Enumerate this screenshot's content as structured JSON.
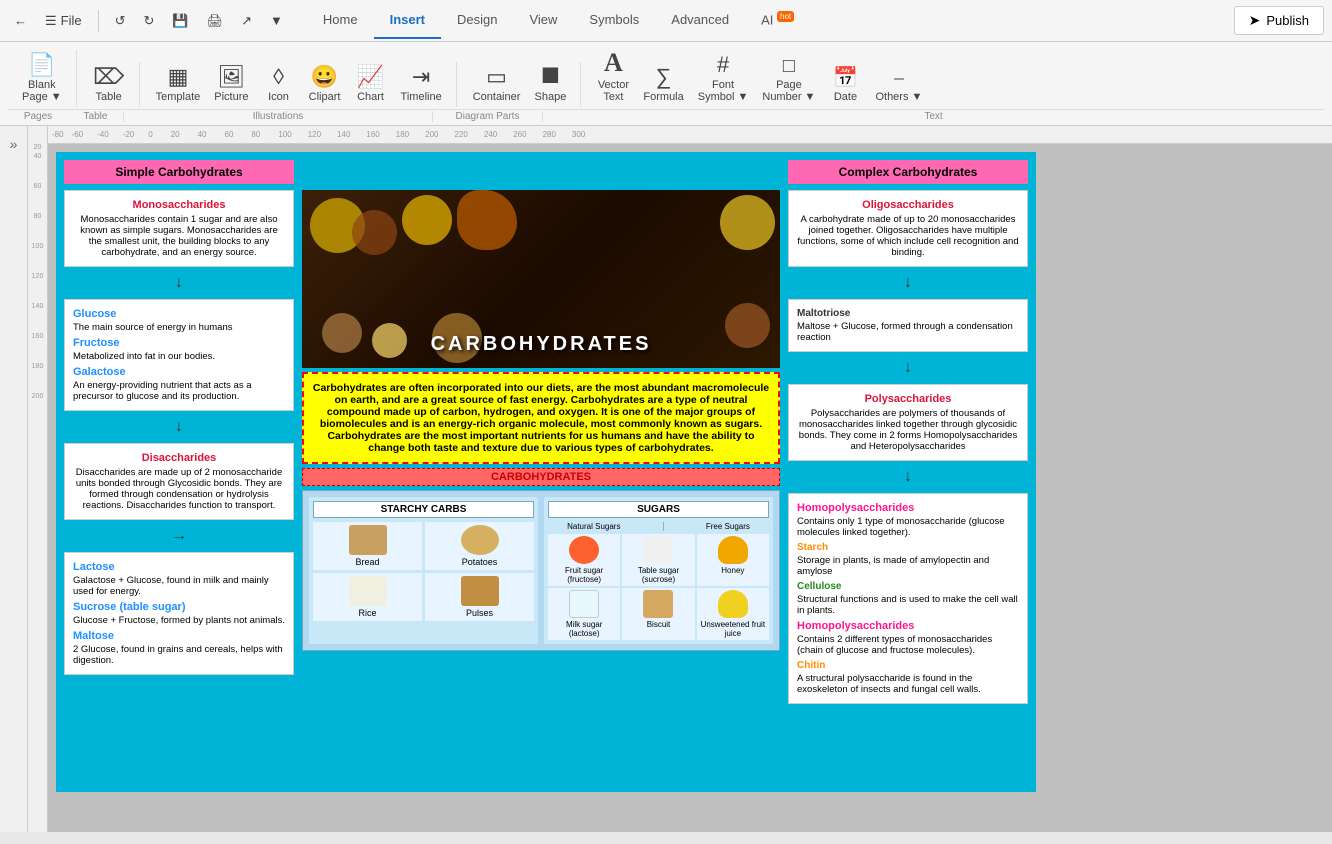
{
  "topbar": {
    "back_label": "←",
    "menu_label": "☰",
    "file_label": "File",
    "undo_label": "↺",
    "redo_label": "↻",
    "save_label": "💾",
    "print_label": "🖨",
    "export_label": "↗",
    "more_label": "▾",
    "publish_label": "Publish"
  },
  "nav": {
    "tabs": [
      {
        "label": "Home",
        "active": false
      },
      {
        "label": "Insert",
        "active": true
      },
      {
        "label": "Design",
        "active": false
      },
      {
        "label": "View",
        "active": false
      },
      {
        "label": "Symbols",
        "active": false
      },
      {
        "label": "Advanced",
        "active": false
      },
      {
        "label": "AI",
        "active": false,
        "badge": "hot"
      }
    ]
  },
  "toolbar": {
    "sections": {
      "pages": {
        "label": "Pages",
        "items": [
          {
            "id": "blank-page",
            "icon": "📄",
            "label": "Blank\nPage ▾"
          }
        ]
      },
      "table": {
        "label": "Table",
        "items": [
          {
            "id": "table",
            "icon": "▦",
            "label": "Table"
          }
        ]
      },
      "illustrations": {
        "label": "Illustrations",
        "items": [
          {
            "id": "template",
            "icon": "⊞",
            "label": "Template"
          },
          {
            "id": "picture",
            "icon": "🖼",
            "label": "Picture"
          },
          {
            "id": "icon",
            "icon": "◈",
            "label": "Icon"
          },
          {
            "id": "clipart",
            "icon": "😊",
            "label": "Clipart"
          },
          {
            "id": "chart",
            "icon": "📊",
            "label": "Chart"
          },
          {
            "id": "timeline",
            "icon": "⊟",
            "label": "Timeline"
          }
        ]
      },
      "diagram": {
        "label": "Diagram Parts",
        "items": [
          {
            "id": "container",
            "icon": "▭",
            "label": "Container"
          },
          {
            "id": "shape",
            "icon": "⬠",
            "label": "Shape"
          }
        ]
      },
      "text": {
        "label": "Text",
        "items": [
          {
            "id": "vector-text",
            "icon": "A",
            "label": "Vector\nText"
          },
          {
            "id": "formula",
            "icon": "Σ",
            "label": "Formula"
          },
          {
            "id": "font-symbol",
            "icon": "#",
            "label": "Font\nSymbol ▾"
          },
          {
            "id": "page-number",
            "icon": "⊡",
            "label": "Page\nNumber ▾"
          },
          {
            "id": "date",
            "icon": "📅",
            "label": "Date"
          },
          {
            "id": "others",
            "icon": "⊡",
            "label": "Others ▾"
          }
        ]
      }
    }
  },
  "canvas": {
    "title": "CARBOHYDRATES",
    "left": {
      "top_label": "Simple Carbohydrates",
      "monosaccharides": {
        "title": "Monosaccharides",
        "text": "Monosaccharides contain 1 sugar and are also known as simple sugars. Monosaccharides are the smallest unit, the building blocks to any carbohydrate, and an energy source."
      },
      "glucose": {
        "title": "Glucose",
        "text": "The main source of energy in humans"
      },
      "fructose": {
        "title": "Fructose",
        "text": "Metabolized into fat in our bodies."
      },
      "galactose": {
        "title": "Galactose",
        "text": "An energy-providing nutrient that acts as a precursor to glucose and its production."
      },
      "disaccharides": {
        "title": "Disaccharides",
        "text": "Disaccharides are made up of 2 monosaccharide units bonded through Glycosidic bonds. They are formed through condensation or hydrolysis reactions. Disaccharides function to transport."
      },
      "lactose": {
        "title": "Lactose",
        "text": "Galactose + Glucose, found in milk and mainly used for energy."
      },
      "sucrose": {
        "title": "Sucrose (table sugar)",
        "text": "Glucose + Fructose, formed by plants not animals."
      },
      "maltose": {
        "title": "Maltose",
        "text": "2 Glucose, found in grains and cereals, helps with digestion."
      }
    },
    "center": {
      "description": "Carbohydrates are often incorporated into our diets, are the most abundant macromolecule on earth, and are a great source of fast energy. Carbohydrates are a type of neutral compound made up of carbon, hydrogen, and oxygen. It is one of the major groups of biomolecules and is an energy-rich organic molecule, most commonly known as sugars. Carbohydrates are the most important nutrients for us humans and have the ability to change both taste and texture due to various types of carbohydrates.",
      "bottom_label": "CARBOHYDRATES",
      "starchy_carbs": {
        "title": "STARCHY CARBS",
        "items": [
          {
            "label": "Bread"
          },
          {
            "label": "Potatoes"
          },
          {
            "label": "Rice"
          },
          {
            "label": "Pulses"
          }
        ]
      },
      "sugars": {
        "title": "SUGARS",
        "natural_sugars": "Natural Sugars",
        "free_sugars": "Free Sugars",
        "items": [
          {
            "label": "Fruit sugar (fructose)"
          },
          {
            "label": "Table sugar (sucrose)"
          },
          {
            "label": "Honey"
          },
          {
            "label": "Milk sugar (lactose)"
          },
          {
            "label": "Biscuit"
          },
          {
            "label": "Unsweetened fruit juice"
          }
        ]
      }
    },
    "right": {
      "top_label": "Complex Carbohydrates",
      "oligosaccharides": {
        "title": "Oligosaccharides",
        "text": "A carbohydrate made of up to 20 monosaccharides joined together. Oligosaccharides have multiple functions, some of which include cell recognition and binding."
      },
      "maltotriose": {
        "title": "Maltotriose",
        "text": "Maltose + Glucose, formed through a condensation reaction"
      },
      "polysaccharides": {
        "title": "Polysaccharides",
        "text": "Polysaccharides are polymers of thousands of monosaccharides linked together through glycosidic bonds. They come in 2 forms Homopolysaccharides and Heteropolysaccharides"
      },
      "homopolysaccharides1": {
        "title": "Homopolysaccharides",
        "text": "Contains only 1 type of monosaccharide (glucose molecules linked together)."
      },
      "starch": {
        "title": "Starch",
        "text": "Storage in plants, is made of amylopectin and amylose"
      },
      "cellulose": {
        "title": "Cellulose",
        "text": "Structural functions and is used to make the cell wall in plants."
      },
      "homopolysaccharides2": {
        "title": "Homopolysaccharides",
        "text": "Contains 2 different types of monosaccharides (chain of glucose and fructose molecules)."
      },
      "chitin": {
        "title": "Chitin",
        "text": "A structural polysaccharide is found in the exoskeleton of insects and fungal cell walls."
      }
    }
  }
}
